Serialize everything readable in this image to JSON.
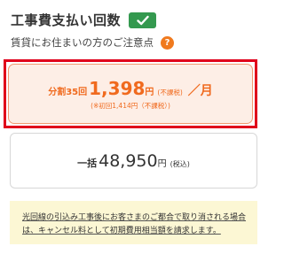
{
  "header": {
    "title": "工事費支払い回数",
    "badge_icon": "check-icon",
    "badge_color": "#34994f"
  },
  "notice_row": {
    "text": "賃貸にお住まいの方のご注意点",
    "help_icon_glyph": "?",
    "help_color": "#f07a1e"
  },
  "options": {
    "installment": {
      "label": "分割35回",
      "amount": "1,398",
      "yen": "円",
      "tax": "(不課税)",
      "per": "／月",
      "first_note": "(※初回1,414円（不課税）)",
      "selected": true,
      "accent": "#f06a1e",
      "highlight_border": "#e0001b"
    },
    "lump_sum": {
      "label": "一括",
      "amount": "48,950",
      "yen": "円",
      "tax": "(税込)",
      "selected": false
    }
  },
  "notice_box": {
    "line1": "光回線の引込み工事後にお客さまのご都合で取り消される場合",
    "line2": "は、キャンセル料として初期費用相当額を請求します。",
    "background": "#fcf7d4"
  }
}
